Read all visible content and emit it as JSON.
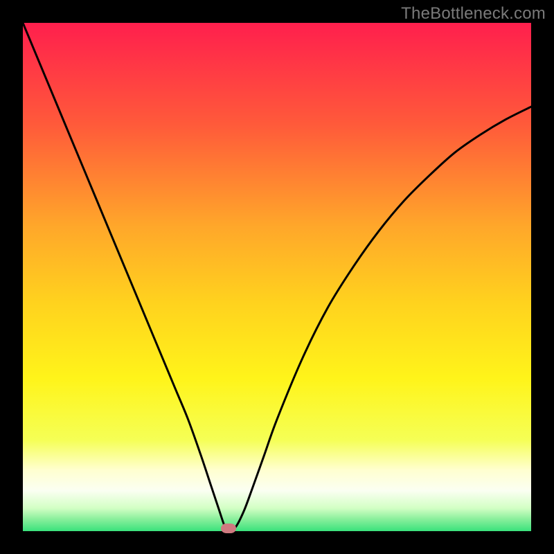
{
  "watermark": {
    "text": "TheBottleneck.com"
  },
  "chart_data": {
    "type": "line",
    "title": "",
    "xlabel": "",
    "ylabel": "",
    "xlim": [
      0,
      100
    ],
    "ylim": [
      0,
      100
    ],
    "grid": false,
    "legend": false,
    "background": {
      "type": "vertical-gradient",
      "stops": [
        {
          "offset": 0.0,
          "color": "#ff1f4d"
        },
        {
          "offset": 0.2,
          "color": "#ff5a3a"
        },
        {
          "offset": 0.4,
          "color": "#ffa72a"
        },
        {
          "offset": 0.55,
          "color": "#ffd21e"
        },
        {
          "offset": 0.7,
          "color": "#fff41a"
        },
        {
          "offset": 0.82,
          "color": "#f5ff55"
        },
        {
          "offset": 0.88,
          "color": "#ffffd0"
        },
        {
          "offset": 0.92,
          "color": "#fbfff2"
        },
        {
          "offset": 0.955,
          "color": "#d2ffc4"
        },
        {
          "offset": 0.975,
          "color": "#8ef09e"
        },
        {
          "offset": 1.0,
          "color": "#3ae27c"
        }
      ]
    },
    "series": [
      {
        "name": "bottleneck-curve",
        "color": "#000000",
        "stroke_width": 3,
        "x": [
          0,
          2.5,
          5,
          7.5,
          10,
          12.5,
          15,
          17.5,
          20,
          22.5,
          25,
          27.5,
          30,
          32.5,
          35,
          37,
          38.5,
          39.5,
          40,
          41,
          42,
          43.5,
          45,
          47.5,
          50,
          55,
          60,
          65,
          70,
          75,
          80,
          85,
          90,
          95,
          100
        ],
        "y": [
          100,
          94,
          88,
          82,
          76,
          70,
          64,
          58,
          52,
          46,
          40,
          34,
          28,
          22,
          15,
          9,
          4.5,
          1.5,
          0.5,
          0.3,
          1,
          4,
          8,
          15,
          22,
          34,
          44,
          52,
          59,
          65,
          70,
          74.5,
          78,
          81,
          83.5
        ]
      }
    ],
    "marker": {
      "name": "optimal-point",
      "x": 40.5,
      "y": 0.5,
      "color": "#cf7a80",
      "shape": "rounded-rect"
    }
  }
}
